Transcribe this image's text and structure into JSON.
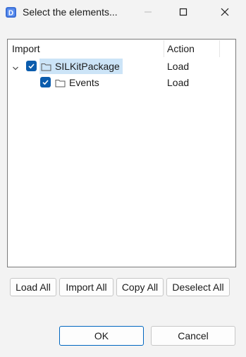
{
  "window": {
    "title": "Select the elements...",
    "app_icon": "d-app-icon",
    "controls": [
      "minimize-icon",
      "maximize-icon",
      "close-icon"
    ]
  },
  "tree": {
    "columns": {
      "import": "Import",
      "action": "Action"
    },
    "rows": [
      {
        "label": "SILKitPackage",
        "action": "Load",
        "checked": true,
        "expanded": true,
        "selected": true,
        "icon": "folder-icon"
      },
      {
        "label": "Events",
        "action": "Load",
        "checked": true,
        "icon": "folder-icon"
      }
    ]
  },
  "buttons": {
    "load_all": "Load All",
    "import_all": "Import All",
    "copy_all": "Copy All",
    "deselect_all": "Deselect All",
    "ok": "OK",
    "cancel": "Cancel"
  },
  "colors": {
    "checkbox": "#0b5cad",
    "selection": "#cce4f7",
    "default_button_border": "#0067c0"
  }
}
